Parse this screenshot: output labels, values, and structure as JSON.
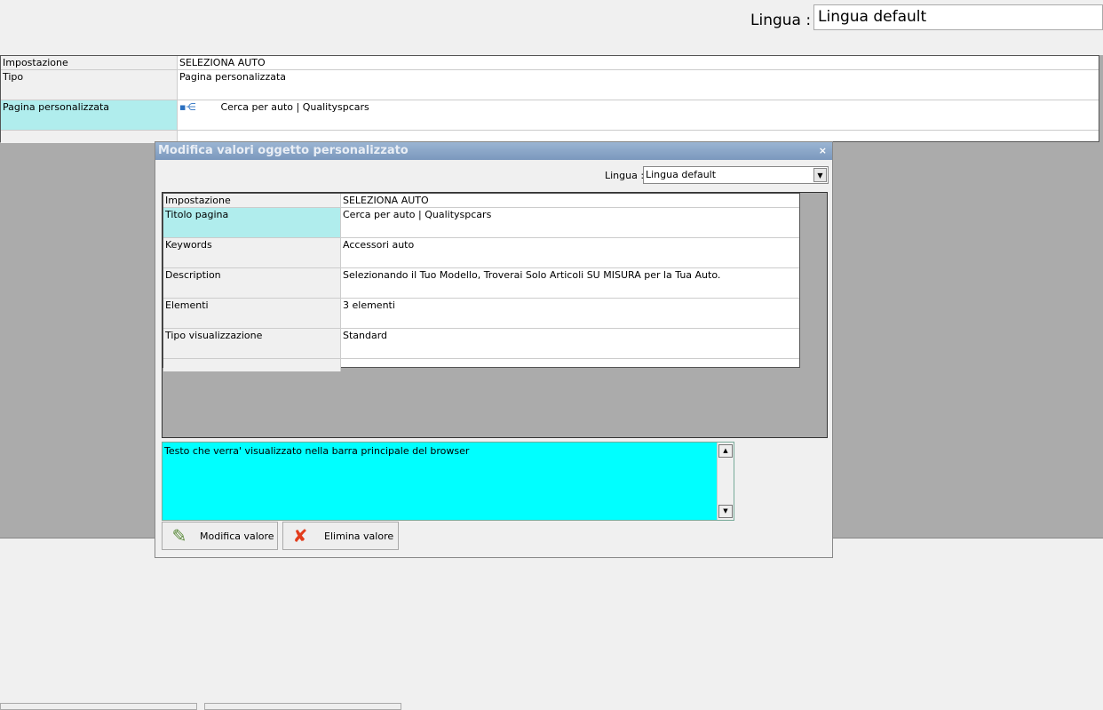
{
  "header": {
    "lang_label": "Lingua :",
    "lang_value": "Lingua default"
  },
  "outer_grid": {
    "header": [
      "Impostazione",
      "SELEZIONA AUTO"
    ],
    "rows": [
      [
        "Tipo",
        "Pagina personalizzata"
      ],
      [
        "Pagina personalizzata",
        "Cerca per auto | Qualityspcars"
      ]
    ]
  },
  "dialog": {
    "title": "Modifica valori oggetto personalizzato",
    "close": "×",
    "lang_label": "Lingua :",
    "lang_value": "Lingua default",
    "grid": {
      "header": [
        "Impostazione",
        "SELEZIONA AUTO"
      ],
      "rows": [
        [
          "Titolo pagina",
          "Cerca per auto | Qualityspcars"
        ],
        [
          "Keywords",
          "Accessori auto"
        ],
        [
          "Description",
          "Selezionando il Tuo Modello, Troverai Solo Articoli SU MISURA per la Tua Auto."
        ],
        [
          "Elementi",
          "3 elementi"
        ],
        [
          "Tipo visualizzazione",
          "Standard"
        ]
      ]
    },
    "description": "Testo che verra' visualizzato nella barra principale del browser",
    "modify_button": "Modifica valore",
    "delete_button": "Elimina valore"
  }
}
